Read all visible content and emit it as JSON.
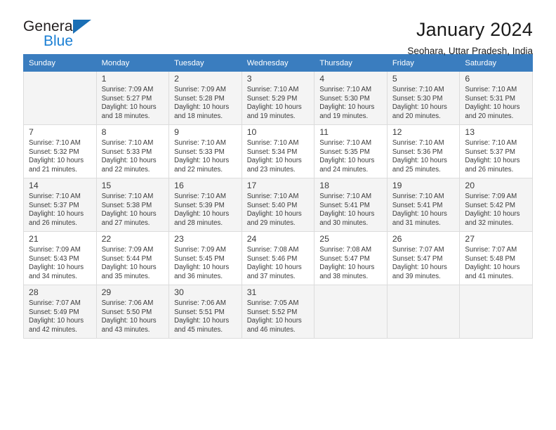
{
  "brand": {
    "name_top": "General",
    "name_bottom": "Blue",
    "accent_color": "#1a7fd4",
    "triangle_color": "#1a6fb5"
  },
  "header": {
    "title": "January 2024",
    "subtitle": "Seohara, Uttar Pradesh, India"
  },
  "theme": {
    "header_row_bg": "#3a7dbf",
    "header_row_text": "#ffffff",
    "alt_row_bg": "#f4f4f4",
    "grid_line": "#dcdcdc",
    "text": "#3b3b3b"
  },
  "calendar": {
    "weekday_headers": [
      "Sunday",
      "Monday",
      "Tuesday",
      "Wednesday",
      "Thursday",
      "Friday",
      "Saturday"
    ],
    "labels": {
      "sunrise": "Sunrise:",
      "sunset": "Sunset:",
      "daylight": "Daylight:"
    },
    "weeks": [
      [
        {
          "day": "",
          "info": ""
        },
        {
          "day": "1",
          "info": "Sunrise: 7:09 AM\nSunset: 5:27 PM\nDaylight: 10 hours\nand 18 minutes."
        },
        {
          "day": "2",
          "info": "Sunrise: 7:09 AM\nSunset: 5:28 PM\nDaylight: 10 hours\nand 18 minutes."
        },
        {
          "day": "3",
          "info": "Sunrise: 7:10 AM\nSunset: 5:29 PM\nDaylight: 10 hours\nand 19 minutes."
        },
        {
          "day": "4",
          "info": "Sunrise: 7:10 AM\nSunset: 5:30 PM\nDaylight: 10 hours\nand 19 minutes."
        },
        {
          "day": "5",
          "info": "Sunrise: 7:10 AM\nSunset: 5:30 PM\nDaylight: 10 hours\nand 20 minutes."
        },
        {
          "day": "6",
          "info": "Sunrise: 7:10 AM\nSunset: 5:31 PM\nDaylight: 10 hours\nand 20 minutes."
        }
      ],
      [
        {
          "day": "7",
          "info": "Sunrise: 7:10 AM\nSunset: 5:32 PM\nDaylight: 10 hours\nand 21 minutes."
        },
        {
          "day": "8",
          "info": "Sunrise: 7:10 AM\nSunset: 5:33 PM\nDaylight: 10 hours\nand 22 minutes."
        },
        {
          "day": "9",
          "info": "Sunrise: 7:10 AM\nSunset: 5:33 PM\nDaylight: 10 hours\nand 22 minutes."
        },
        {
          "day": "10",
          "info": "Sunrise: 7:10 AM\nSunset: 5:34 PM\nDaylight: 10 hours\nand 23 minutes."
        },
        {
          "day": "11",
          "info": "Sunrise: 7:10 AM\nSunset: 5:35 PM\nDaylight: 10 hours\nand 24 minutes."
        },
        {
          "day": "12",
          "info": "Sunrise: 7:10 AM\nSunset: 5:36 PM\nDaylight: 10 hours\nand 25 minutes."
        },
        {
          "day": "13",
          "info": "Sunrise: 7:10 AM\nSunset: 5:37 PM\nDaylight: 10 hours\nand 26 minutes."
        }
      ],
      [
        {
          "day": "14",
          "info": "Sunrise: 7:10 AM\nSunset: 5:37 PM\nDaylight: 10 hours\nand 26 minutes."
        },
        {
          "day": "15",
          "info": "Sunrise: 7:10 AM\nSunset: 5:38 PM\nDaylight: 10 hours\nand 27 minutes."
        },
        {
          "day": "16",
          "info": "Sunrise: 7:10 AM\nSunset: 5:39 PM\nDaylight: 10 hours\nand 28 minutes."
        },
        {
          "day": "17",
          "info": "Sunrise: 7:10 AM\nSunset: 5:40 PM\nDaylight: 10 hours\nand 29 minutes."
        },
        {
          "day": "18",
          "info": "Sunrise: 7:10 AM\nSunset: 5:41 PM\nDaylight: 10 hours\nand 30 minutes."
        },
        {
          "day": "19",
          "info": "Sunrise: 7:10 AM\nSunset: 5:41 PM\nDaylight: 10 hours\nand 31 minutes."
        },
        {
          "day": "20",
          "info": "Sunrise: 7:09 AM\nSunset: 5:42 PM\nDaylight: 10 hours\nand 32 minutes."
        }
      ],
      [
        {
          "day": "21",
          "info": "Sunrise: 7:09 AM\nSunset: 5:43 PM\nDaylight: 10 hours\nand 34 minutes."
        },
        {
          "day": "22",
          "info": "Sunrise: 7:09 AM\nSunset: 5:44 PM\nDaylight: 10 hours\nand 35 minutes."
        },
        {
          "day": "23",
          "info": "Sunrise: 7:09 AM\nSunset: 5:45 PM\nDaylight: 10 hours\nand 36 minutes."
        },
        {
          "day": "24",
          "info": "Sunrise: 7:08 AM\nSunset: 5:46 PM\nDaylight: 10 hours\nand 37 minutes."
        },
        {
          "day": "25",
          "info": "Sunrise: 7:08 AM\nSunset: 5:47 PM\nDaylight: 10 hours\nand 38 minutes."
        },
        {
          "day": "26",
          "info": "Sunrise: 7:07 AM\nSunset: 5:47 PM\nDaylight: 10 hours\nand 39 minutes."
        },
        {
          "day": "27",
          "info": "Sunrise: 7:07 AM\nSunset: 5:48 PM\nDaylight: 10 hours\nand 41 minutes."
        }
      ],
      [
        {
          "day": "28",
          "info": "Sunrise: 7:07 AM\nSunset: 5:49 PM\nDaylight: 10 hours\nand 42 minutes."
        },
        {
          "day": "29",
          "info": "Sunrise: 7:06 AM\nSunset: 5:50 PM\nDaylight: 10 hours\nand 43 minutes."
        },
        {
          "day": "30",
          "info": "Sunrise: 7:06 AM\nSunset: 5:51 PM\nDaylight: 10 hours\nand 45 minutes."
        },
        {
          "day": "31",
          "info": "Sunrise: 7:05 AM\nSunset: 5:52 PM\nDaylight: 10 hours\nand 46 minutes."
        },
        {
          "day": "",
          "info": ""
        },
        {
          "day": "",
          "info": ""
        },
        {
          "day": "",
          "info": ""
        }
      ]
    ]
  }
}
